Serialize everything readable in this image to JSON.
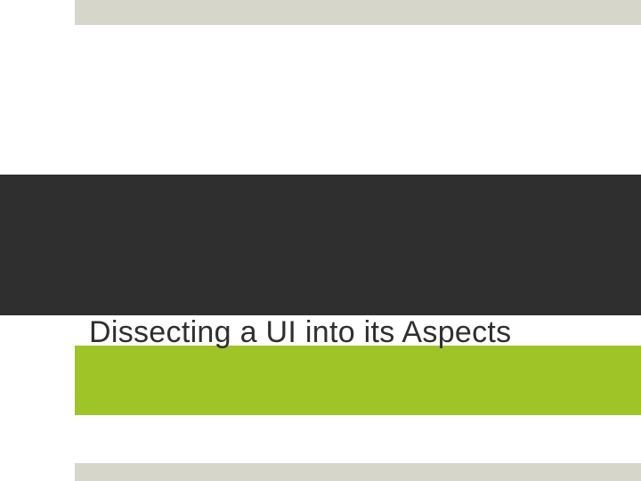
{
  "slide": {
    "title": "Dissecting a UI into its Aspects"
  }
}
